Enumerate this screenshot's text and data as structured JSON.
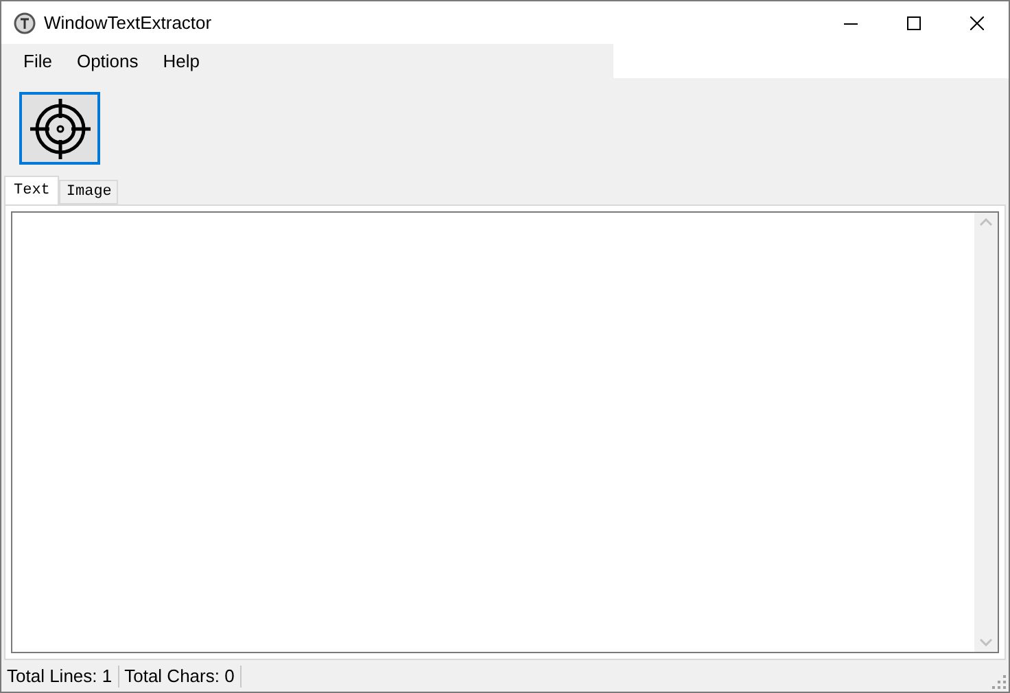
{
  "window": {
    "title": "WindowTextExtractor"
  },
  "menu": [
    "File",
    "Options",
    "Help"
  ],
  "tabs": [
    {
      "label": "Text",
      "selected": true
    },
    {
      "label": "Image",
      "selected": false
    }
  ],
  "status_bar": [
    "Total Lines: 1",
    "Total Chars: 0"
  ]
}
